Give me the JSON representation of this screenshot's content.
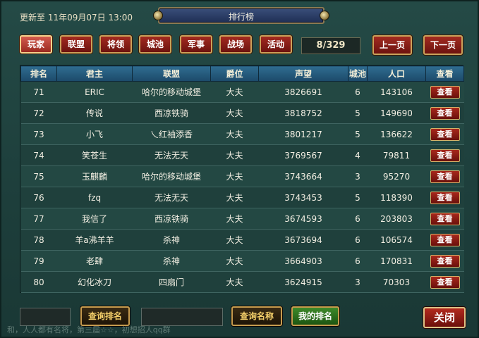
{
  "header": {
    "update_label": "更新至",
    "update_time": "11年09月07日 13:00",
    "title": "排行榜"
  },
  "tabs": [
    {
      "label": "玩家",
      "active": true
    },
    {
      "label": "联盟",
      "active": false
    },
    {
      "label": "将领",
      "active": false
    },
    {
      "label": "城池",
      "active": false
    },
    {
      "label": "军事",
      "active": false
    },
    {
      "label": "战场",
      "active": false
    },
    {
      "label": "活动",
      "active": false
    }
  ],
  "pager": {
    "page_text": "8/329",
    "prev_label": "上一页",
    "next_label": "下一页"
  },
  "table": {
    "columns": [
      "排名",
      "君主",
      "联盟",
      "爵位",
      "声望",
      "城池",
      "人口",
      "查看"
    ],
    "view_label": "查看",
    "rows": [
      [
        "71",
        "ERIC",
        "哈尔的移动城堡",
        "大夫",
        "3826691",
        "6",
        "143106"
      ],
      [
        "72",
        "传说",
        "西凉铁骑",
        "大夫",
        "3818752",
        "5",
        "149690"
      ],
      [
        "73",
        "小飞",
        "乀红袖添香",
        "大夫",
        "3801217",
        "5",
        "136622"
      ],
      [
        "74",
        "笑苍生",
        "无法无天",
        "大夫",
        "3769567",
        "4",
        "79811"
      ],
      [
        "75",
        "玉麒麟",
        "哈尔的移动城堡",
        "大夫",
        "3743664",
        "3",
        "95270"
      ],
      [
        "76",
        "fzq",
        "无法无天",
        "大夫",
        "3743453",
        "5",
        "118390"
      ],
      [
        "77",
        "我信了",
        "西凉铁骑",
        "大夫",
        "3674593",
        "6",
        "203803"
      ],
      [
        "78",
        "羊a沸羊羊",
        "杀神",
        "大夫",
        "3673694",
        "6",
        "106574"
      ],
      [
        "79",
        "老肆",
        "杀神",
        "大夫",
        "3664903",
        "6",
        "170831"
      ],
      [
        "80",
        "幻化冰刀",
        "四扇门",
        "大夫",
        "3624915",
        "3",
        "70303"
      ]
    ]
  },
  "footer": {
    "rank_query_value": "",
    "rank_query_label": "查询排名",
    "name_query_value": "",
    "name_query_label": "查询名称",
    "my_rank_label": "我的排名",
    "close_label": "关闭"
  },
  "background_chat": "和，人人都有名将，第三届☆☆，初想招人qq群"
}
